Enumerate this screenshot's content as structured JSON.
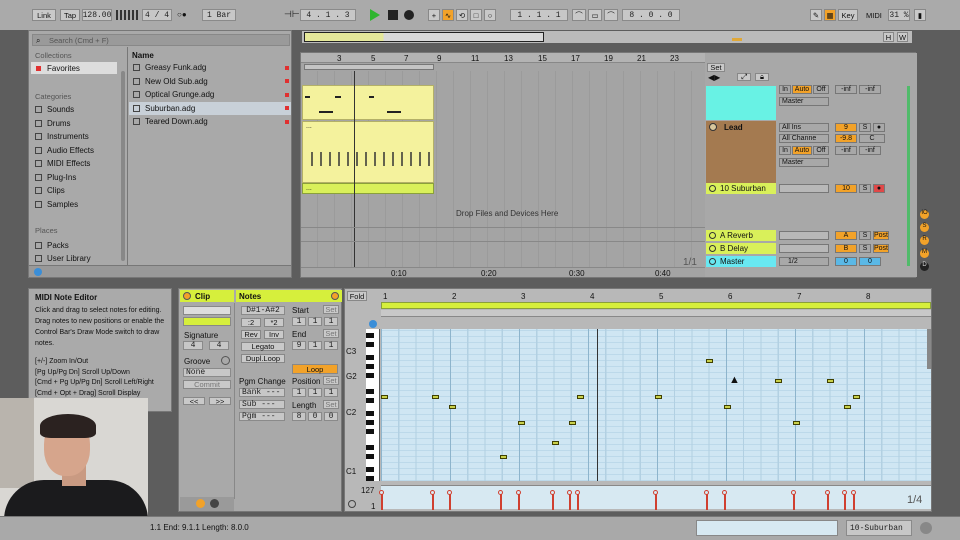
{
  "control_bar": {
    "link": "Link",
    "tap": "Tap",
    "tempo": "128.00",
    "signature": "4 / 4",
    "quantization": "1 Bar",
    "position": "4 . 1 . 3",
    "loop_start": "1 . 1 . 1",
    "loop_length": "8 . 0 . 0",
    "key": "Key",
    "midi": "MIDI",
    "cpu": "31 %"
  },
  "browser": {
    "search_placeholder": "Search (Cmd + F)",
    "collections_header": "Collections",
    "favorites": "Favorites",
    "categories_header": "Categories",
    "categories": [
      "Sounds",
      "Drums",
      "Instruments",
      "Audio Effects",
      "MIDI Effects",
      "Plug-Ins",
      "Clips",
      "Samples"
    ],
    "places_header": "Places",
    "places": [
      "Packs",
      "User Library"
    ],
    "name_header": "Name",
    "files": [
      "Greasy Funk.adg",
      "New Old Sub.adg",
      "Optical Grunge.adg",
      "Suburban.adg",
      "Teared Down.adg"
    ]
  },
  "arrangement": {
    "ruler": [
      "3",
      "5",
      "7",
      "9",
      "11",
      "13",
      "15",
      "17",
      "19",
      "21",
      "23"
    ],
    "time_ruler": [
      "0:10",
      "0:20",
      "0:30",
      "0:40"
    ],
    "drop_text": "Drop Files and Devices Here",
    "page": "1/1",
    "clip_label": "..."
  },
  "mixer": {
    "set_label": "Set",
    "tracks": [
      {
        "name": "Lead",
        "input": "All Ins",
        "channel": "All Channe",
        "monitor_in": "In",
        "monitor_auto": "Auto",
        "monitor_off": "Off",
        "out": "Master",
        "vol": "9",
        "vol_val": "-9.8",
        "pan": "C",
        "inf1": "-inf",
        "inf2": "-inf",
        "solo": "S"
      },
      {
        "name": "10 Suburban",
        "vol": "10",
        "solo": "S"
      },
      {
        "name": "A Reverb",
        "vol": "A",
        "solo": "S",
        "post": "Post"
      },
      {
        "name": "B Delay",
        "vol": "B",
        "solo": "S",
        "post": "Post"
      },
      {
        "name": "Master",
        "vol": "0",
        "pan": "0",
        "ratio": "1/2"
      }
    ],
    "top_in": "In",
    "top_auto": "Auto",
    "top_off": "Off",
    "top_out": "Master",
    "top_inf1": "-inf",
    "top_inf2": "-inf"
  },
  "info": {
    "title": "MIDI Note Editor",
    "body": "Click and drag to select notes for editing. Drag notes to new positions or enable the Control Bar's Draw Mode switch to draw notes.",
    "shortcuts": [
      "[+/-] Zoom In/Out",
      "[Pg Up/Pg Dn] Scroll Up/Down",
      "[Cmd + Pg Up/Pg Dn] Scroll Left/Right",
      "[Cmd + Opt + Drag] Scroll Display"
    ]
  },
  "clip_view": {
    "clip_tab": "Clip",
    "notes_tab": "Notes",
    "signature_label": "Signature",
    "sig_num": "4",
    "sig_den": "4",
    "groove_label": "Groove",
    "groove_value": "None",
    "commit": "Commit",
    "range": "D#1-A#2",
    "div2": ":2",
    "mul2": "*2",
    "rev": "Rev",
    "inv": "Inv",
    "legato": "Legato",
    "dupl": "Dupl.Loop",
    "pgm_change": "Pgm Change",
    "bank": "Bank ---",
    "sub": "Sub ---",
    "pgm": "Pgm ---",
    "start_label": "Start",
    "start_val": [
      "1",
      "1",
      "1"
    ],
    "end_label": "End",
    "end_val": [
      "9",
      "1",
      "1"
    ],
    "loop": "Loop",
    "position_label": "Position",
    "position_val": [
      "1",
      "1",
      "1"
    ],
    "length_label": "Length",
    "length_val": [
      "8",
      "0",
      "0"
    ],
    "set": "Set"
  },
  "note_editor": {
    "fold": "Fold",
    "bars": [
      "1",
      "2",
      "3",
      "4",
      "5",
      "6",
      "7",
      "8"
    ],
    "pitch_labels": [
      "C3",
      "G2",
      "C2",
      "C1"
    ],
    "vel_max": "127",
    "vel_min": "1",
    "page": "1/4"
  },
  "status": {
    "text": "1.1   End: 9.1.1   Length: 8.0.0",
    "track": "10-Suburban"
  }
}
